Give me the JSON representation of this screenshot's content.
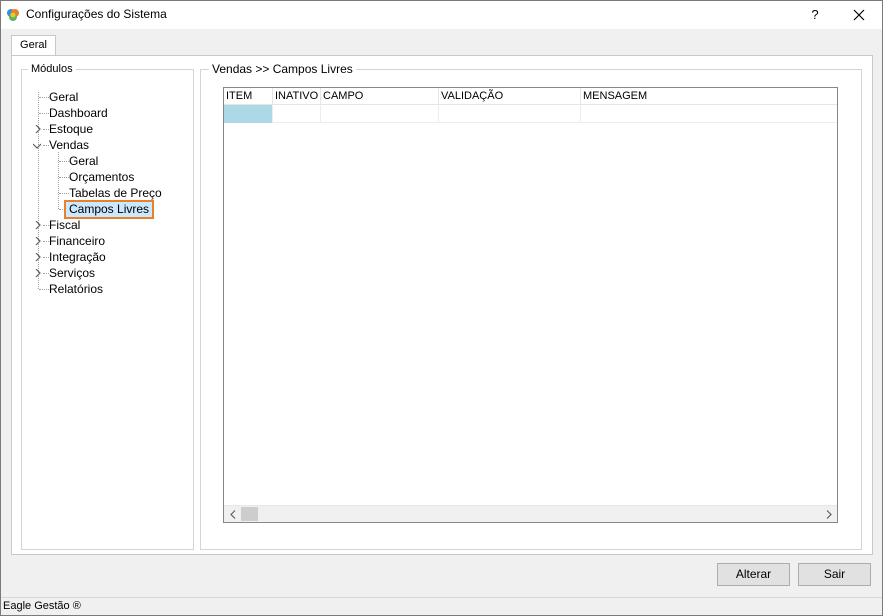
{
  "window": {
    "title": "Configurações do Sistema",
    "help_label": "?",
    "close_label": "✕"
  },
  "tabs": [
    {
      "label": "Geral",
      "active": true
    }
  ],
  "modules": {
    "legend": "Módulos",
    "items": [
      {
        "label": "Geral",
        "expandable": false
      },
      {
        "label": "Dashboard",
        "expandable": false
      },
      {
        "label": "Estoque",
        "expandable": true,
        "expanded": false
      },
      {
        "label": "Vendas",
        "expandable": true,
        "expanded": true,
        "children": [
          {
            "label": "Geral"
          },
          {
            "label": "Orçamentos"
          },
          {
            "label": "Tabelas de Preço"
          },
          {
            "label": "Campos Livres",
            "selected": true
          }
        ]
      },
      {
        "label": "Fiscal",
        "expandable": true,
        "expanded": false
      },
      {
        "label": "Financeiro",
        "expandable": true,
        "expanded": false
      },
      {
        "label": "Integração",
        "expandable": true,
        "expanded": false
      },
      {
        "label": "Serviços",
        "expandable": true,
        "expanded": false
      },
      {
        "label": "Relatórios",
        "expandable": false
      }
    ]
  },
  "panel": {
    "legend": "Vendas >> Campos Livres",
    "columns": [
      "ITEM",
      "INATIVO",
      "CAMPO",
      "VALIDAÇÃO",
      "MENSAGEM"
    ],
    "rows": [
      [
        "",
        "",
        "",
        "",
        ""
      ]
    ]
  },
  "buttons": {
    "alterar": "Alterar",
    "sair": "Sair"
  },
  "status": {
    "text": "Eagle Gestão ®"
  },
  "colors": {
    "selection_border": "#e8822a",
    "selection_fill": "#cce8ff",
    "grid_selected_cell": "#add8e6"
  }
}
